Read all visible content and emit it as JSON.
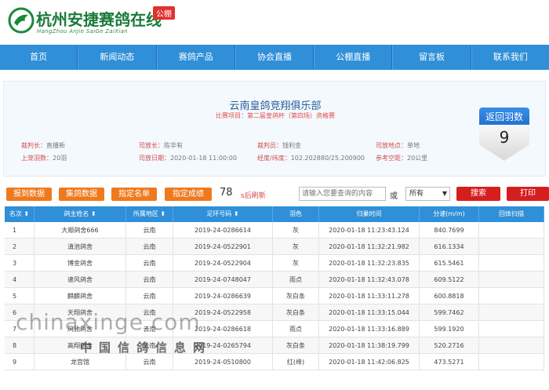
{
  "header": {
    "title": "杭州安捷赛鸽在线",
    "subtitle": "HangZhou AnJie SaiGe ZaiXian",
    "tag": "公棚"
  },
  "nav": [
    "首页",
    "新闻动态",
    "赛鸽产品",
    "协会直播",
    "公棚直播",
    "留言板",
    "联系我们"
  ],
  "race": {
    "club": "云南皇鸽竞翔俱乐部",
    "project": "比赛项目：第二届皇鸽杯（第四场）资格赛",
    "referee": {
      "k": "裁判长：",
      "v": "直播新"
    },
    "releaser": {
      "k": "司放长：",
      "v": "陈华有"
    },
    "recorder": {
      "k": "裁判员：",
      "v": "钱利金"
    },
    "location": {
      "k": "司放地点：",
      "v": "单地"
    },
    "count": {
      "k": "上笼羽数：",
      "v": "20羽"
    },
    "date": {
      "k": "司放日期：",
      "v": "2020-01-18 11:00:00"
    },
    "coords": {
      "k": "经度/纬度：",
      "v": "102.202880/25.200900"
    },
    "distance": {
      "k": "参考空距：",
      "v": "20公里"
    }
  },
  "badge": {
    "label": "返回羽数",
    "value": "9"
  },
  "toolbar": {
    "btn_report": "报到数据",
    "btn_collect": "集鸽数据",
    "btn_rank": "指定名单",
    "btn_score": "指定成绩",
    "count": "78",
    "refresh": "s后刷新",
    "search_placeholder": "请输入您要查询的内容",
    "or": "或",
    "select_value": "所有",
    "btn_search": "搜索",
    "btn_print": "打印"
  },
  "table": {
    "headers": [
      "名次",
      "鸽主姓名",
      "所属地区",
      "足环号码",
      "羽色",
      "归巢时间",
      "分速(m/m)",
      "回体扫描"
    ],
    "rows": [
      [
        "1",
        "大顺鸽舍666",
        "云南",
        "2019-24-0286614",
        "灰",
        "2020-01-18 11:23:43.124",
        "840.7699",
        ""
      ],
      [
        "2",
        "滇池鸽舍",
        "云南",
        "2019-24-0522901",
        "灰",
        "2020-01-18 11:32:21.982",
        "616.1334",
        ""
      ],
      [
        "3",
        "博金鸽舍",
        "云南",
        "2019-24-0522904",
        "灰",
        "2020-01-18 11:32:23.835",
        "615.5461",
        ""
      ],
      [
        "4",
        "速风鸽舍",
        "云南",
        "2019-24-0748047",
        "雨点",
        "2020-01-18 11:32:43.078",
        "609.5122",
        ""
      ],
      [
        "5",
        "麒麟鸽舍",
        "云南",
        "2019-24-0286639",
        "灰白条",
        "2020-01-18 11:33:11.278",
        "600.8818",
        ""
      ],
      [
        "6",
        "天翔鸽舍",
        "云南",
        "2019-24-0522958",
        "灰白条",
        "2020-01-18 11:33:15.044",
        "599.7462",
        ""
      ],
      [
        "7",
        "风驰鸽舍",
        "云南",
        "2019-24-0286618",
        "雨点",
        "2020-01-18 11:33:16.889",
        "599.1920",
        ""
      ],
      [
        "8",
        "高翔鸽舍",
        "云南",
        "2019-24-0265794",
        "灰白条",
        "2020-01-18 11:38:19.799",
        "520.2716",
        ""
      ],
      [
        "9",
        "龙宫馆",
        "云南",
        "2019-24-0510800",
        "红(绛)",
        "2020-01-18 11:42:06.825",
        "473.5271",
        ""
      ]
    ]
  },
  "watermark": {
    "domain": "chinaxinge.com",
    "name": "中国信鸽信息网"
  }
}
